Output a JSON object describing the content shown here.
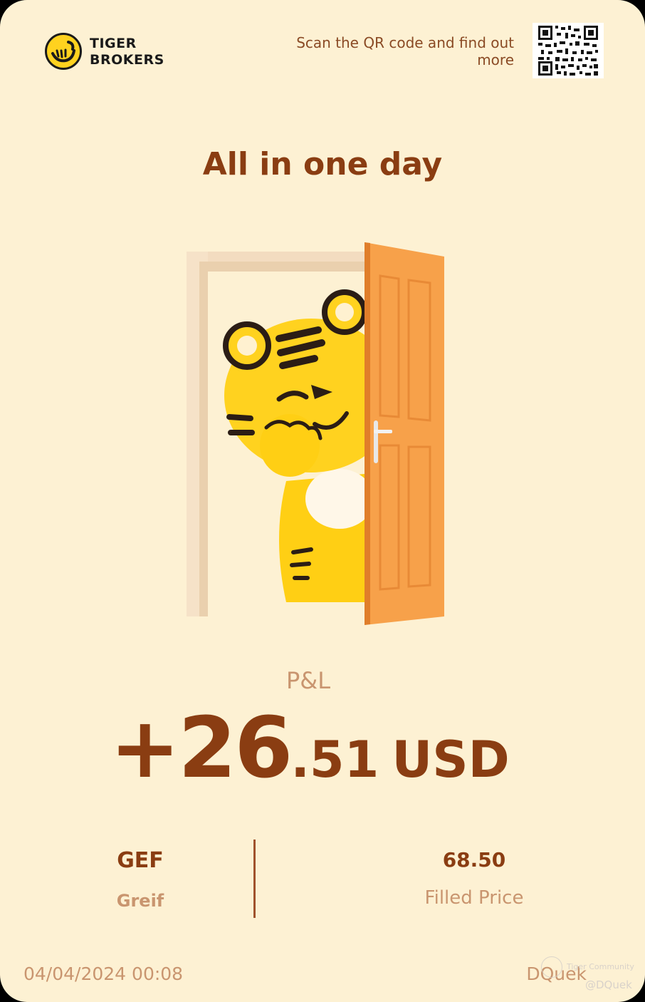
{
  "header": {
    "brand_line1": "TIGER",
    "brand_line2": "BROKERS",
    "scan_text": "Scan the QR code and find out more"
  },
  "title": "All in one day",
  "pnl": {
    "label": "P&L",
    "integer_part": "+26",
    "decimal_part": ".51",
    "currency": "USD"
  },
  "stock": {
    "ticker": "GEF",
    "name": "Greif",
    "price": "68.50",
    "price_label": "Filled Price"
  },
  "footer": {
    "date": "04/04/2024 00:08",
    "user": "DQuek",
    "watermark_line1": "Tiger Community",
    "watermark_line2": "@DQuek"
  },
  "colors": {
    "background": "#fdf1d3",
    "primary_text": "#8a3d12",
    "muted_text": "#c9956f",
    "door": "#f7a14a",
    "tiger": "#ffd21f"
  }
}
